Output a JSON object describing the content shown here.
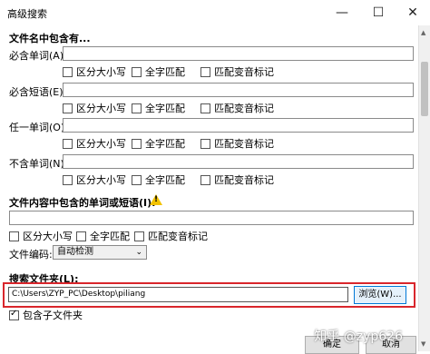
{
  "window": {
    "title": "高级搜索",
    "minimize_glyph": "—",
    "maximize_glyph": "☐",
    "close_glyph": "✕"
  },
  "filename_section": {
    "heading": "文件名中包含有...",
    "must_contain_word": {
      "label": "必含单词(A):",
      "value": ""
    },
    "must_contain_phrase": {
      "label": "必含短语(E):",
      "value": ""
    },
    "any_word": {
      "label": "任一单词(O):",
      "value": ""
    },
    "exclude_word": {
      "label": "不含单词(N):",
      "value": ""
    },
    "options": {
      "case": "区分大小写",
      "whole_word": "全字匹配",
      "diacritics": "匹配变音标记"
    }
  },
  "content_section": {
    "heading": "文件内容中包含的单词或短语(I):",
    "warning_icon": "warning-icon",
    "value": "",
    "options": {
      "case": "区分大小写",
      "whole_word": "全字匹配",
      "diacritics": "匹配变音标记"
    },
    "encoding_label": "文件编码:",
    "encoding_value": "自动检测"
  },
  "folder_section": {
    "heading": "搜索文件夹(L):",
    "path": "C:\\Users\\ZYP_PC\\Desktop\\piliang",
    "browse_label": "浏览(W)...",
    "include_subfolders_label": "包含子文件夹",
    "include_subfolders_checked": true
  },
  "footer": {
    "ok_label": "确定",
    "cancel_label": "取消"
  },
  "watermark": "知乎 @zyp626",
  "colors": {
    "highlight": "#d9262c",
    "browse_border": "#0078d7",
    "warning": "#f2c200"
  }
}
